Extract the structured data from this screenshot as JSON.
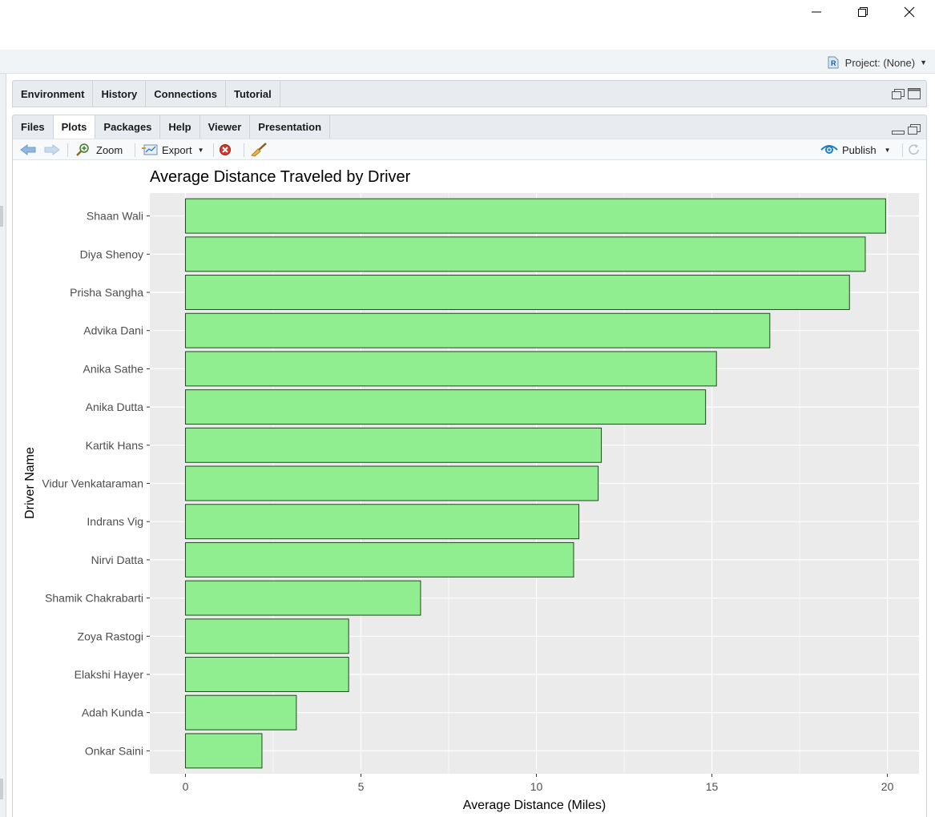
{
  "window": {
    "minimize_label": "minimize",
    "restore_label": "restore",
    "close_label": "close"
  },
  "project": {
    "label": "Project: (None)"
  },
  "top_pane": {
    "tabs": [
      {
        "label": "Environment"
      },
      {
        "label": "History"
      },
      {
        "label": "Connections"
      },
      {
        "label": "Tutorial"
      }
    ]
  },
  "bottom_pane": {
    "tabs": [
      {
        "label": "Files"
      },
      {
        "label": "Plots",
        "active": true
      },
      {
        "label": "Packages"
      },
      {
        "label": "Help"
      },
      {
        "label": "Viewer"
      },
      {
        "label": "Presentation"
      }
    ],
    "toolbar": {
      "zoom_label": "Zoom",
      "export_label": "Export",
      "publish_label": "Publish"
    }
  },
  "colors": {
    "bar_fill": "#90ee90",
    "bar_stroke": "#1f4a1f",
    "panel_bg": "#ebebeb",
    "grid": "#ffffff",
    "accent": "#1b7fc1",
    "close_red": "#c0392b"
  },
  "chart_data": {
    "type": "bar",
    "orientation": "horizontal",
    "title": "Average Distance Traveled by Driver",
    "xlabel": "Average Distance (Miles)",
    "ylabel": "Driver Name",
    "categories": [
      "Shaan Wali",
      "Diya Shenoy",
      "Prisha Sangha",
      "Advika Dani",
      "Anika Sathe",
      "Anika Dutta",
      "Kartik Hans",
      "Vidur Venkataraman",
      "Indrans Vig",
      "Nirvi Datta",
      "Shamik Chakrabarti",
      "Zoya Rastogi",
      "Elakshi Hayer",
      "Adah Kunda",
      "Onkar Saini"
    ],
    "values": [
      19.95,
      19.37,
      18.92,
      16.65,
      15.13,
      14.82,
      11.85,
      11.76,
      11.21,
      11.06,
      6.7,
      4.65,
      4.65,
      3.16,
      2.18
    ],
    "xlim": [
      -1.015,
      20.9
    ],
    "xticks": [
      "0",
      "5",
      "10",
      "15",
      "20"
    ],
    "xtick_values": [
      0,
      5,
      10,
      15,
      20
    ],
    "grid": true,
    "legend": "none"
  }
}
